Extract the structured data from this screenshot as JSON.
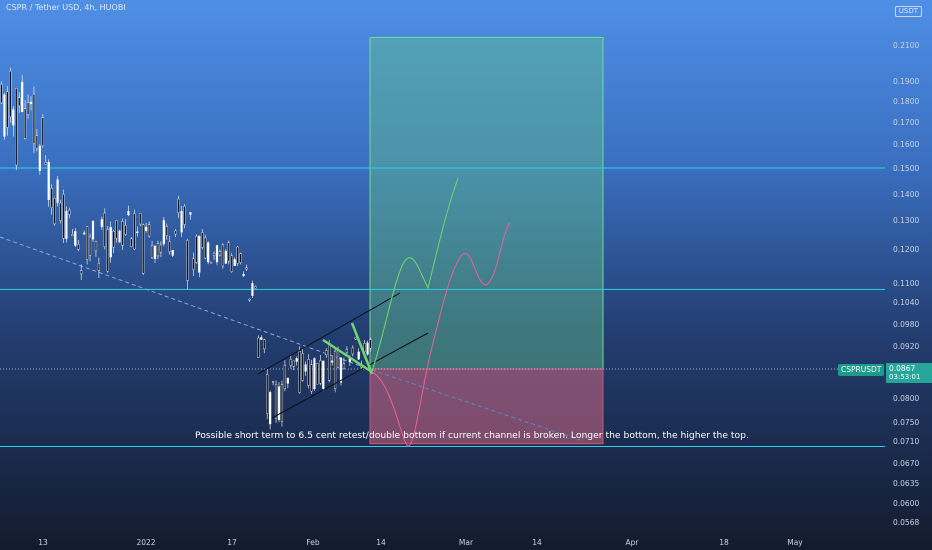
{
  "header": {
    "symbol_line": "CSPR / Tether USD, 4h, HUOBI",
    "currency_badge": "USDT"
  },
  "annotation_text": "Possible short term to 6.5 cent retest/double bottom if current channel is broken. Longer the bottom, the higher the top.",
  "price_label": {
    "ticker": "CSPRUSDT",
    "price": "0.0867",
    "countdown": "03:53:01"
  },
  "colors": {
    "horizontal_line": "#2fd0e6",
    "profit_zone": "#5fbf8f",
    "loss_zone": "#e06a86",
    "projection_green": "#6fd66f",
    "projection_pink": "#ef5f90",
    "candle": "#ffffff",
    "price_tag": "#26a69a"
  },
  "chart_data": {
    "type": "candlestick",
    "title": "CSPR / Tether USD, 4h, HUOBI",
    "y_axis_labels": [
      "0.2100",
      "0.1900",
      "0.1800",
      "0.1700",
      "0.1600",
      "0.1500",
      "0.1400",
      "0.1300",
      "0.1200",
      "0.1100",
      "0.1040",
      "0.0980",
      "0.0920",
      "0.0800",
      "0.0750",
      "0.0710",
      "0.0670",
      "0.0635",
      "0.0600",
      "0.0568"
    ],
    "x_axis_labels": [
      "13",
      "2022",
      "17",
      "Feb",
      "14",
      "Mar",
      "14",
      "Apr",
      "18",
      "May"
    ],
    "current_price": 0.0867,
    "horizontal_levels": [
      0.15,
      0.108,
      0.07
    ],
    "position_box": {
      "entry": 0.0867,
      "target": 0.2142,
      "stop": 0.0705
    },
    "series_points": [
      [
        0.192,
        0.155
      ],
      [
        0.198,
        0.145
      ],
      [
        0.2,
        0.16
      ],
      [
        0.188,
        0.148
      ],
      [
        0.176,
        0.142
      ],
      [
        0.16,
        0.133
      ],
      [
        0.146,
        0.128
      ],
      [
        0.14,
        0.122
      ],
      [
        0.132,
        0.115
      ],
      [
        0.128,
        0.112
      ],
      [
        0.134,
        0.118
      ],
      [
        0.135,
        0.112
      ],
      [
        0.13,
        0.11
      ],
      [
        0.135,
        0.118
      ],
      [
        0.14,
        0.12
      ],
      [
        0.133,
        0.116
      ],
      [
        0.129,
        0.112
      ],
      [
        0.132,
        0.116
      ],
      [
        0.131,
        0.114
      ],
      [
        0.136,
        0.118
      ],
      [
        0.14,
        0.122
      ],
      [
        0.133,
        0.11
      ],
      [
        0.128,
        0.113
      ],
      [
        0.126,
        0.116
      ],
      [
        0.125,
        0.114
      ],
      [
        0.123,
        0.114
      ],
      [
        0.121,
        0.113
      ],
      [
        0.12,
        0.112
      ],
      [
        0.111,
        0.104
      ],
      [
        0.098,
        0.088
      ],
      [
        0.086,
        0.074
      ],
      [
        0.085,
        0.075
      ],
      [
        0.089,
        0.079
      ],
      [
        0.091,
        0.081
      ],
      [
        0.094,
        0.082
      ],
      [
        0.09,
        0.08
      ],
      [
        0.092,
        0.081
      ],
      [
        0.093,
        0.082
      ],
      [
        0.095,
        0.083
      ],
      [
        0.097,
        0.087
      ],
      [
        0.095,
        0.086
      ],
      [
        0.094,
        0.086
      ]
    ]
  }
}
